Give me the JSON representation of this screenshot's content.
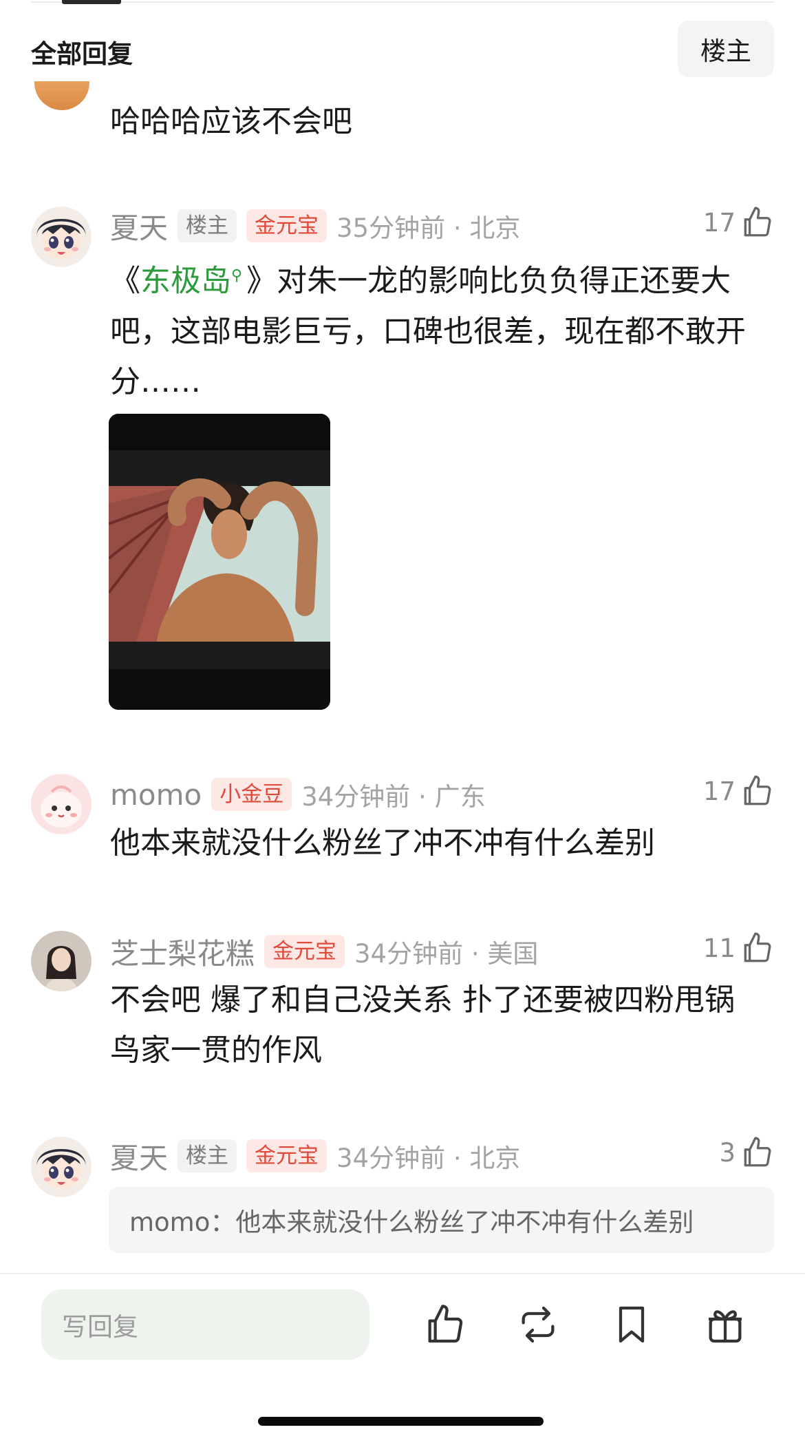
{
  "header": {
    "section_title": "全部回复",
    "op_filter_label": "楼主"
  },
  "prev_comment": {
    "text": "哈哈哈应该不会吧"
  },
  "comments": [
    {
      "username": "夏天",
      "badges": [
        "楼主",
        "金元宝"
      ],
      "meta": "35分钟前 · 北京",
      "likes": "17",
      "text_before": "《",
      "topic": "东极岛",
      "text_after": "》对朱一龙的影响比负负得正还要大吧，这部电影巨亏，口碑也很差，现在都不敢开分……",
      "has_image": true
    },
    {
      "username": "momo",
      "badges": [
        "小金豆"
      ],
      "meta": "34分钟前 · 广东",
      "likes": "17",
      "text": "他本来就没什么粉丝了冲不冲有什么差别"
    },
    {
      "username": "芝士梨花糕",
      "badges": [
        "金元宝"
      ],
      "meta": "34分钟前 · 美国",
      "likes": "11",
      "text": "不会吧 爆了和自己没关系 扑了还要被四粉甩锅 鸟家一贯的作风"
    },
    {
      "username": "夏天",
      "badges": [
        "楼主",
        "金元宝"
      ],
      "meta": "34分钟前 · 北京",
      "likes": "3",
      "quote": "momo：他本来就没什么粉丝了冲不冲有什么差别"
    }
  ],
  "bottom_bar": {
    "reply_placeholder": "写回复",
    "actions": [
      "like-icon",
      "repost-icon",
      "bookmark-icon",
      "gift-icon"
    ]
  },
  "colors": {
    "accent_green": "#2d9a3c",
    "gold_badge": "#e04a3a",
    "muted": "#8a8a8a"
  }
}
